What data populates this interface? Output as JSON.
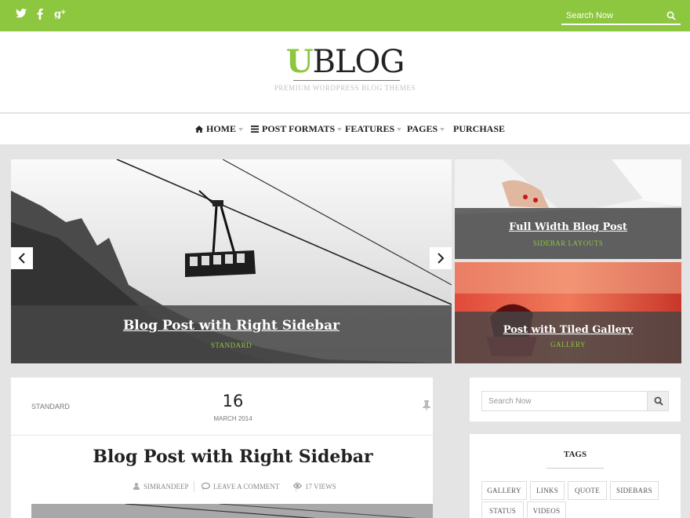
{
  "topbar": {
    "social": [
      {
        "icon": "twitter-icon",
        "glyph": "✶"
      },
      {
        "icon": "facebook-icon",
        "glyph": "f"
      },
      {
        "icon": "google-plus-icon",
        "glyph": "g+"
      }
    ],
    "search_placeholder": "Search Now",
    "accent_color": "#8dc63f"
  },
  "header": {
    "logo_letter": "U",
    "logo_rest": "BLOG",
    "tagline": "PREMIUM WORDPRESS BLOG THEMES"
  },
  "nav": {
    "items": [
      {
        "label": "HOME",
        "icon": "home-icon",
        "dropdown": true
      },
      {
        "label": "POST FORMATS",
        "icon": "menu-icon",
        "dropdown": true
      },
      {
        "label": "FEATURES",
        "dropdown": true
      },
      {
        "label": "PAGES",
        "dropdown": true
      },
      {
        "label": "PURCHASE",
        "dropdown": false
      }
    ]
  },
  "slider": {
    "title": "Blog Post with Right Sidebar",
    "category": "STANDARD"
  },
  "featured": [
    {
      "title": "Full Width Blog Post",
      "category": "SIDEBAR LAYOUTS"
    },
    {
      "title": "Post with Tiled Gallery",
      "category": "GALLERY"
    }
  ],
  "post": {
    "format": "STANDARD",
    "day": "16",
    "month": "MARCH 2014",
    "title": "Blog Post with Right Sidebar",
    "author": "SIMRANDEEP",
    "comments": "LEAVE A COMMENT",
    "views": "17 VIEWS"
  },
  "sidebar": {
    "search_placeholder": "Search Now",
    "tags_title": "TAGS",
    "tags": [
      "GALLERY",
      "LINKS",
      "QUOTE",
      "SIDEBARS",
      "STATUS",
      "VIDEOS"
    ]
  }
}
